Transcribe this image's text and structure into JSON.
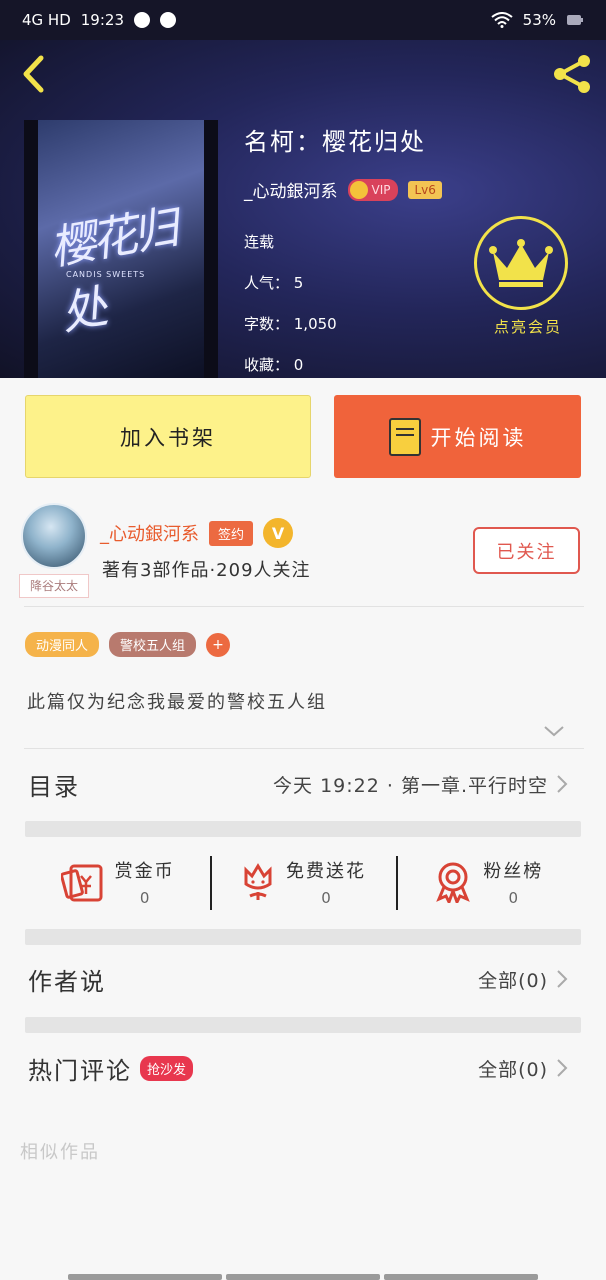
{
  "status_bar": {
    "network": "4G HD",
    "time": "19:23",
    "battery": "53%"
  },
  "book": {
    "title": "名柯：樱花归处",
    "cover_title": "樱花归处",
    "cover_subtitle": "CANDIS SWEETS",
    "author": "_心动銀河系",
    "vip": "VIP",
    "level": "Lv6",
    "status": "连载",
    "popularity": "人气： 5",
    "word_count": "字数： 1,050",
    "favorites": "收藏： 0"
  },
  "member": {
    "label": "点亮会员"
  },
  "actions": {
    "shelf_label": "加入书架",
    "read_label": "开始阅读"
  },
  "author_card": {
    "name": "_心动銀河系",
    "sign_badge": "签约",
    "v_badge": "V",
    "works": "著有3部作品·209人关注",
    "avatar_tag": "降谷太太",
    "follow_label": "已关注"
  },
  "tags": [
    "动漫同人",
    "警校五人组",
    "+"
  ],
  "description": "此篇仅为纪念我最爱的警校五人组",
  "catalog": {
    "label": "目录",
    "latest": "今天 19:22 · 第一章.平行时空"
  },
  "stats": [
    {
      "name": "赏金币",
      "value": "0",
      "icon": "coin-envelope-icon"
    },
    {
      "name": "免费送花",
      "value": "0",
      "icon": "flower-icon"
    },
    {
      "name": "粉丝榜",
      "value": "0",
      "icon": "medal-icon"
    }
  ],
  "author_says": {
    "label": "作者说",
    "all": "全部(0)"
  },
  "comments": {
    "label": "热门评论",
    "badge": "抢沙发",
    "all": "全部(0)"
  },
  "similar": {
    "label": "相似作品"
  },
  "colors": {
    "accent": "#f0633b",
    "shelf": "#fdf28a",
    "gold": "#f2e24a",
    "hot": "#e8374e"
  }
}
